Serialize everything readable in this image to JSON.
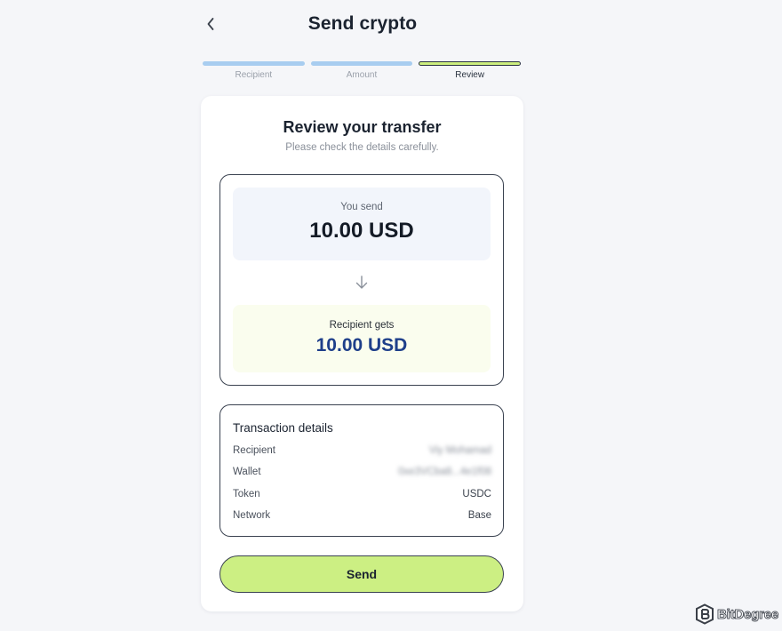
{
  "header": {
    "title": "Send crypto"
  },
  "stepper": {
    "steps": [
      {
        "label": "Recipient",
        "state": "complete"
      },
      {
        "label": "Amount",
        "state": "complete"
      },
      {
        "label": "Review",
        "state": "active"
      }
    ]
  },
  "review": {
    "title": "Review your transfer",
    "subtitle": "Please check the details carefully.",
    "send_caption": "You send",
    "send_amount": "10.00 USD",
    "receive_caption": "Recipient gets",
    "receive_amount": "10.00 USD"
  },
  "details": {
    "title": "Transaction details",
    "rows": [
      {
        "label": "Recipient",
        "value": "Viy Mohamad",
        "blurred": true
      },
      {
        "label": "Wallet",
        "value": "0xe3VCba8...4e1f08",
        "blurred": true
      },
      {
        "label": "Token",
        "value": "USDC",
        "blurred": false
      },
      {
        "label": "Network",
        "value": "Base",
        "blurred": false
      }
    ]
  },
  "actions": {
    "send_label": "Send"
  },
  "watermark": {
    "text": "BitDegree"
  },
  "icons": {
    "back": "chevron-left-icon",
    "arrow": "arrow-down-icon",
    "watermark_logo": "bitdegree-logo-icon"
  },
  "colors": {
    "background": "#f5f6f9",
    "step_complete": "#a8cdf0",
    "step_active": "#cdef7e",
    "send_button": "#ccef83",
    "receive_amount": "#1e3f8a",
    "send_panel_bg": "#f2f5fb",
    "receive_panel_bg": "#fafdee"
  }
}
